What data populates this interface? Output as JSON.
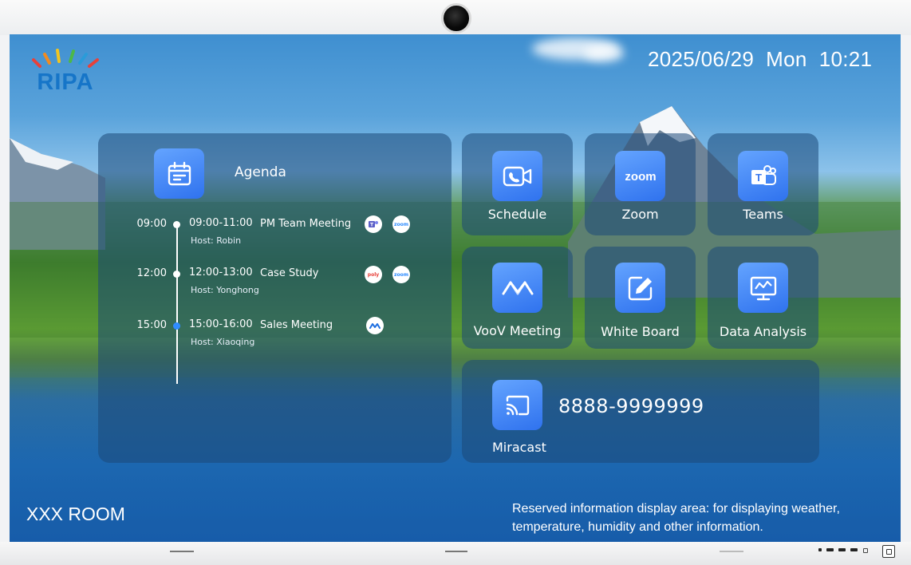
{
  "header": {
    "logo_text": "RIPA",
    "datetime": "2025/06/29  Mon  10:21"
  },
  "agenda": {
    "title": "Agenda",
    "meetings": [
      {
        "slot": "09:00",
        "range": "09:00-11:00",
        "title": "PM Team Meeting",
        "host": "Host:  Robin",
        "apps": [
          "teams-icon",
          "zoom-icon"
        ],
        "active": false
      },
      {
        "slot": "12:00",
        "range": "12:00-13:00",
        "title": "Case Study",
        "host": "Host:  Yonghong",
        "apps": [
          "poly-icon",
          "zoom-icon"
        ],
        "active": false
      },
      {
        "slot": "15:00",
        "range": "15:00-16:00",
        "title": "Sales Meeting",
        "host": "Host:  Xiaoqing",
        "apps": [
          "voov-icon"
        ],
        "active": true
      }
    ]
  },
  "apps": [
    {
      "label": "Schedule",
      "icon": "video-call-icon"
    },
    {
      "label": "Zoom",
      "icon": "zoom-icon"
    },
    {
      "label": "Teams",
      "icon": "teams-icon"
    },
    {
      "label": "VooV Meeting",
      "icon": "voov-icon"
    },
    {
      "label": "White Board",
      "icon": "whiteboard-icon"
    },
    {
      "label": "Data Analysis",
      "icon": "data-analysis-icon"
    }
  ],
  "miracast": {
    "label": "Miracast",
    "number": "8888-9999999",
    "icon": "cast-icon"
  },
  "footer": {
    "room_name": "XXX ROOM",
    "reserved_text": "Reserved information display area: for displaying weather, temperature, humidity and other information."
  },
  "badge_labels": {
    "zoom": "zoom",
    "poly": "poly"
  },
  "colors": {
    "accent": "#2f72ee",
    "panel": "rgba(28,72,120,0.55)",
    "active_dot": "#2f8cff"
  }
}
